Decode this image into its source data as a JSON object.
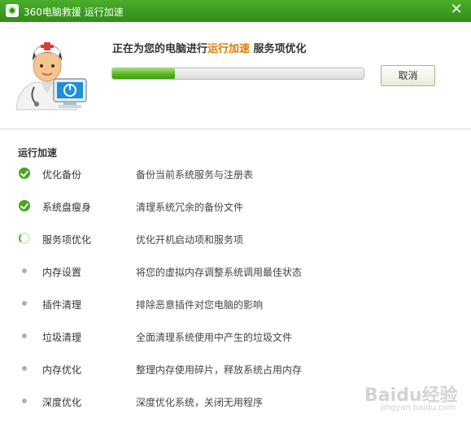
{
  "window": {
    "title": "360电脑救援 运行加速",
    "close_glyph": "✕"
  },
  "status": {
    "prefix": "正在为您的电脑进行",
    "highlight": "运行加速",
    "suffix": " 服务项优化",
    "progress": 0.25,
    "highlight_color": "#e07a00"
  },
  "cancel_label": "取消",
  "section_title": "运行加速",
  "tasks": [
    {
      "name": "优化备份",
      "desc": "备份当前系统服务与注册表",
      "state": "done"
    },
    {
      "name": "系统盘瘦身",
      "desc": "清理系统冗余的备份文件",
      "state": "done"
    },
    {
      "name": "服务项优化",
      "desc": "优化开机启动项和服务项",
      "state": "running"
    },
    {
      "name": "内存设置",
      "desc": "将您的虚拟内存调整系统调用最佳状态",
      "state": "pending"
    },
    {
      "name": "插件清理",
      "desc": "排除恶意插件对您电脑的影响",
      "state": "pending"
    },
    {
      "name": "垃圾清理",
      "desc": "全面清理系统使用中产生的垃圾文件",
      "state": "pending"
    },
    {
      "name": "内存优化",
      "desc": "整理内存使用碎片，释放系统占用内存",
      "state": "pending"
    },
    {
      "name": "深度优化",
      "desc": "深度优化系统，关闭无用程序",
      "state": "pending"
    }
  ],
  "watermark": {
    "text": "Baidu经验",
    "sub": "jingyan.baidu.com"
  },
  "colors": {
    "titlebar": "#3a9a1e",
    "progress_fill": "#4fb51c",
    "done_icon": "#3fa81a"
  }
}
